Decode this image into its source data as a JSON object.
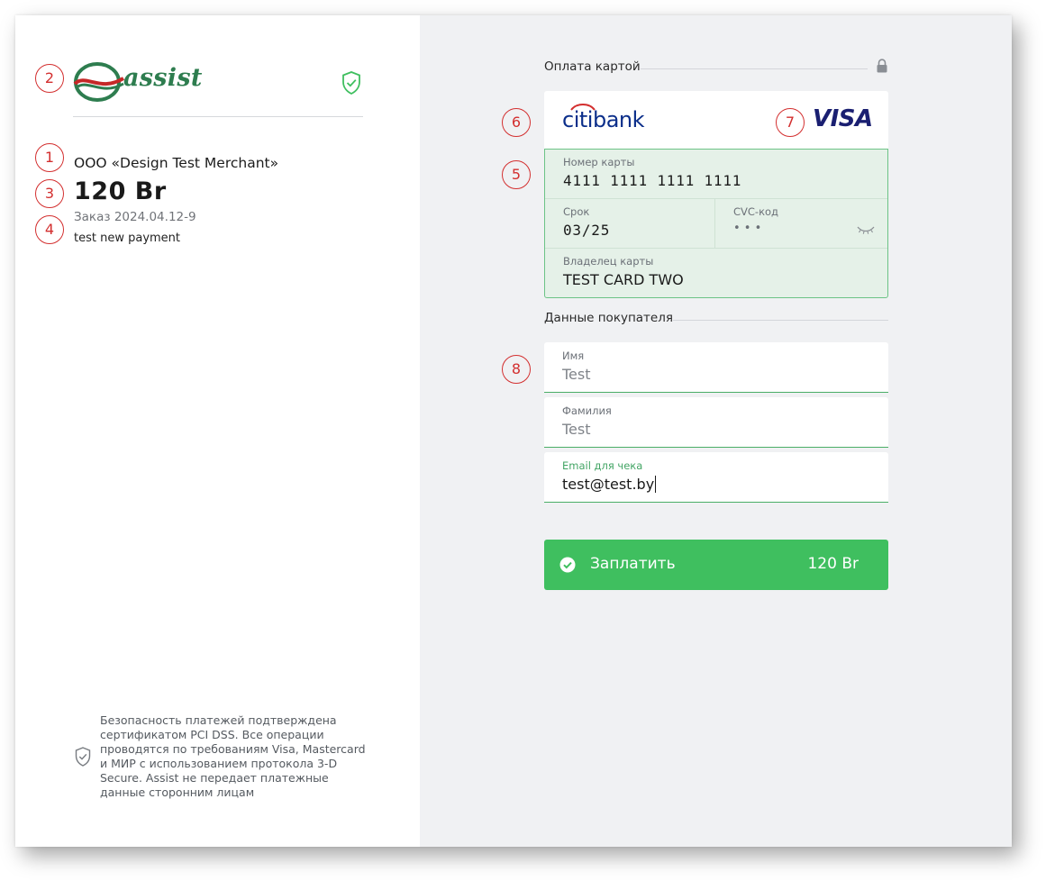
{
  "merchant": {
    "logo_text": "assist",
    "name": "ООО «Design Test Merchant»",
    "amount": "120 Br",
    "order": "Заказ 2024.04.12-9",
    "description": "test new payment",
    "security_note": "Безопасность платежей подтверждена сертификатом PCI DSS. Все операции проводятся по требованиям Visa, Mastercard и МИР с использованием протокола 3-D Secure. Assist не передает платежные данные сторонним лицам"
  },
  "payment": {
    "section_title": "Оплата картой",
    "bank_name_prefix": "citi",
    "bank_name_suffix": "bank",
    "card_brand": "VISA",
    "card_number_label": "Номер карты",
    "card_number": "4111 1111 1111 1111",
    "expiry_label": "Срок",
    "expiry": "03/25",
    "cvc_label": "CVC-код",
    "cvc_masked": "• • •",
    "holder_label": "Владелец карты",
    "holder": "TEST CARD TWO"
  },
  "buyer": {
    "section_title": "Данные покупателя",
    "first_name_label": "Имя",
    "first_name": "Test",
    "last_name_label": "Фамилия",
    "last_name": "Test",
    "email_label": "Email для чека",
    "email": "test@test.by"
  },
  "pay_button": {
    "label": "Заплатить",
    "amount": "120 Br"
  },
  "annotations": [
    "1",
    "2",
    "3",
    "4",
    "5",
    "6",
    "7",
    "8"
  ],
  "colors": {
    "accent_green": "#3fbf5f",
    "annotation_red": "#d32f2f",
    "card_fill": "#e5f1e8",
    "visa_blue": "#1a1f71",
    "citi_blue": "#0b2e8a"
  },
  "icons": [
    "assist-logo",
    "shield-check-icon",
    "lock-icon",
    "eye-closed-icon",
    "check-circle-icon",
    "shield-icon"
  ]
}
